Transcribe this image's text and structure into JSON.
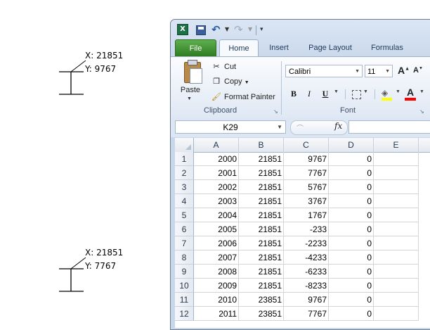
{
  "markers": [
    {
      "x_label": "X: 21851",
      "y_label": "Y: 9767"
    },
    {
      "x_label": "X: 21851",
      "y_label": "Y: 7767"
    }
  ],
  "excel": {
    "quick_access": {
      "logo": "X",
      "undo_icon": "undo-icon",
      "redo_icon": "redo-icon"
    },
    "tabs": [
      "File",
      "Home",
      "Insert",
      "Page Layout",
      "Formulas"
    ],
    "active_tab": "Home",
    "clipboard": {
      "group_label": "Clipboard",
      "paste_label": "Paste",
      "cut_label": "Cut",
      "copy_label": "Copy",
      "format_painter_label": "Format Painter"
    },
    "font": {
      "group_label": "Font",
      "font_name": "Calibri",
      "font_size": "11",
      "bold": "B",
      "italic": "I",
      "underline": "U",
      "font_color_glyph": "A",
      "fill_color": "#ffff00",
      "font_color": "#ff0000"
    },
    "formula_bar": {
      "name_box": "K29",
      "fx_label": "fx",
      "formula": ""
    },
    "columns": [
      "A",
      "B",
      "C",
      "D",
      "E"
    ],
    "rows": [
      {
        "n": "1",
        "cells": [
          "2000",
          "21851",
          "9767",
          "0",
          ""
        ]
      },
      {
        "n": "2",
        "cells": [
          "2001",
          "21851",
          "7767",
          "0",
          ""
        ]
      },
      {
        "n": "3",
        "cells": [
          "2002",
          "21851",
          "5767",
          "0",
          ""
        ]
      },
      {
        "n": "4",
        "cells": [
          "2003",
          "21851",
          "3767",
          "0",
          ""
        ]
      },
      {
        "n": "5",
        "cells": [
          "2004",
          "21851",
          "1767",
          "0",
          ""
        ]
      },
      {
        "n": "6",
        "cells": [
          "2005",
          "21851",
          "-233",
          "0",
          ""
        ]
      },
      {
        "n": "7",
        "cells": [
          "2006",
          "21851",
          "-2233",
          "0",
          ""
        ]
      },
      {
        "n": "8",
        "cells": [
          "2007",
          "21851",
          "-4233",
          "0",
          ""
        ]
      },
      {
        "n": "9",
        "cells": [
          "2008",
          "21851",
          "-6233",
          "0",
          ""
        ]
      },
      {
        "n": "10",
        "cells": [
          "2009",
          "21851",
          "-8233",
          "0",
          ""
        ]
      },
      {
        "n": "11",
        "cells": [
          "2010",
          "23851",
          "9767",
          "0",
          ""
        ]
      },
      {
        "n": "12",
        "cells": [
          "2011",
          "23851",
          "7767",
          "0",
          ""
        ]
      }
    ]
  }
}
